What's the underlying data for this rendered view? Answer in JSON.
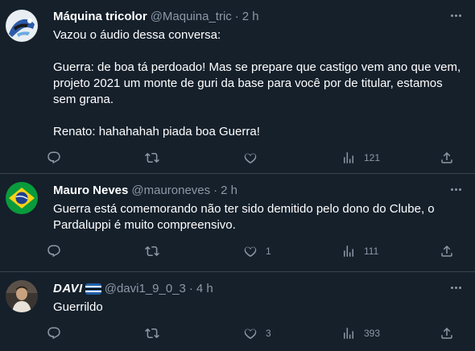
{
  "tweets": [
    {
      "name": "Máquina tricolor",
      "handle": "@Maquina_tric",
      "dot": "·",
      "time": "2 h",
      "text": "Vazou o áudio dessa conversa:\n\nGuerra: de boa tá perdoado! Mas se prepare que castigo vem ano que vem, projeto 2021 um monte de guri da base para você por de titular, estamos sem grana.\n\nRenato: hahahahah piada boa Guerra!",
      "replies": "",
      "retweets": "",
      "likes": "",
      "views": "121"
    },
    {
      "name": "Mauro Neves",
      "handle": "@mauroneves",
      "dot": "·",
      "time": "2 h",
      "text": "Guerra está comemorando não ter sido demitido pelo dono do Clube, o Pardaluppi é muito compreensivo.",
      "replies": "",
      "retweets": "",
      "likes": "1",
      "views": "111"
    },
    {
      "name": "DAVI",
      "handle": "@davi1_9_0_3",
      "dot": "·",
      "time": "4 h",
      "text": "Guerrildo",
      "replies": "",
      "retweets": "",
      "likes": "3",
      "views": "393"
    }
  ],
  "icons": {
    "reply": "reply-icon",
    "retweet": "retweet-icon",
    "like": "like-icon",
    "views": "views-icon",
    "share": "share-icon",
    "more": "more-icon"
  },
  "colors": {
    "background": "#15202b",
    "divider": "#38444d",
    "secondary_text": "#8b98a5",
    "primary_text": "#ffffff"
  }
}
